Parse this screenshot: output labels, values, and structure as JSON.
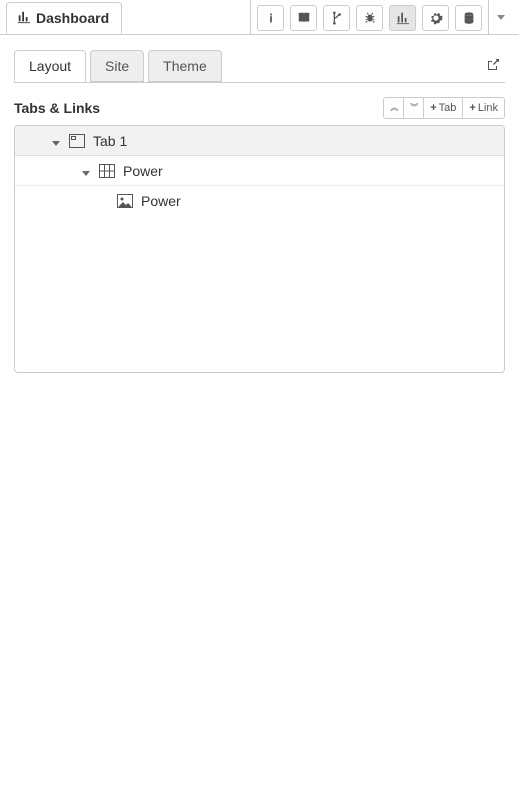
{
  "header": {
    "main_tab_label": "Dashboard"
  },
  "toolbar": {
    "buttons": [
      "info",
      "book",
      "branch",
      "bug",
      "chart",
      "gear",
      "database"
    ]
  },
  "subtabs": {
    "layout": "Layout",
    "site": "Site",
    "theme": "Theme"
  },
  "section": {
    "title": "Tabs & Links",
    "add_tab_label": "Tab",
    "add_link_label": "Link"
  },
  "tree": {
    "root": {
      "label": "Tab 1"
    },
    "child1": {
      "label": "Power"
    },
    "child2": {
      "label": "Power"
    }
  }
}
